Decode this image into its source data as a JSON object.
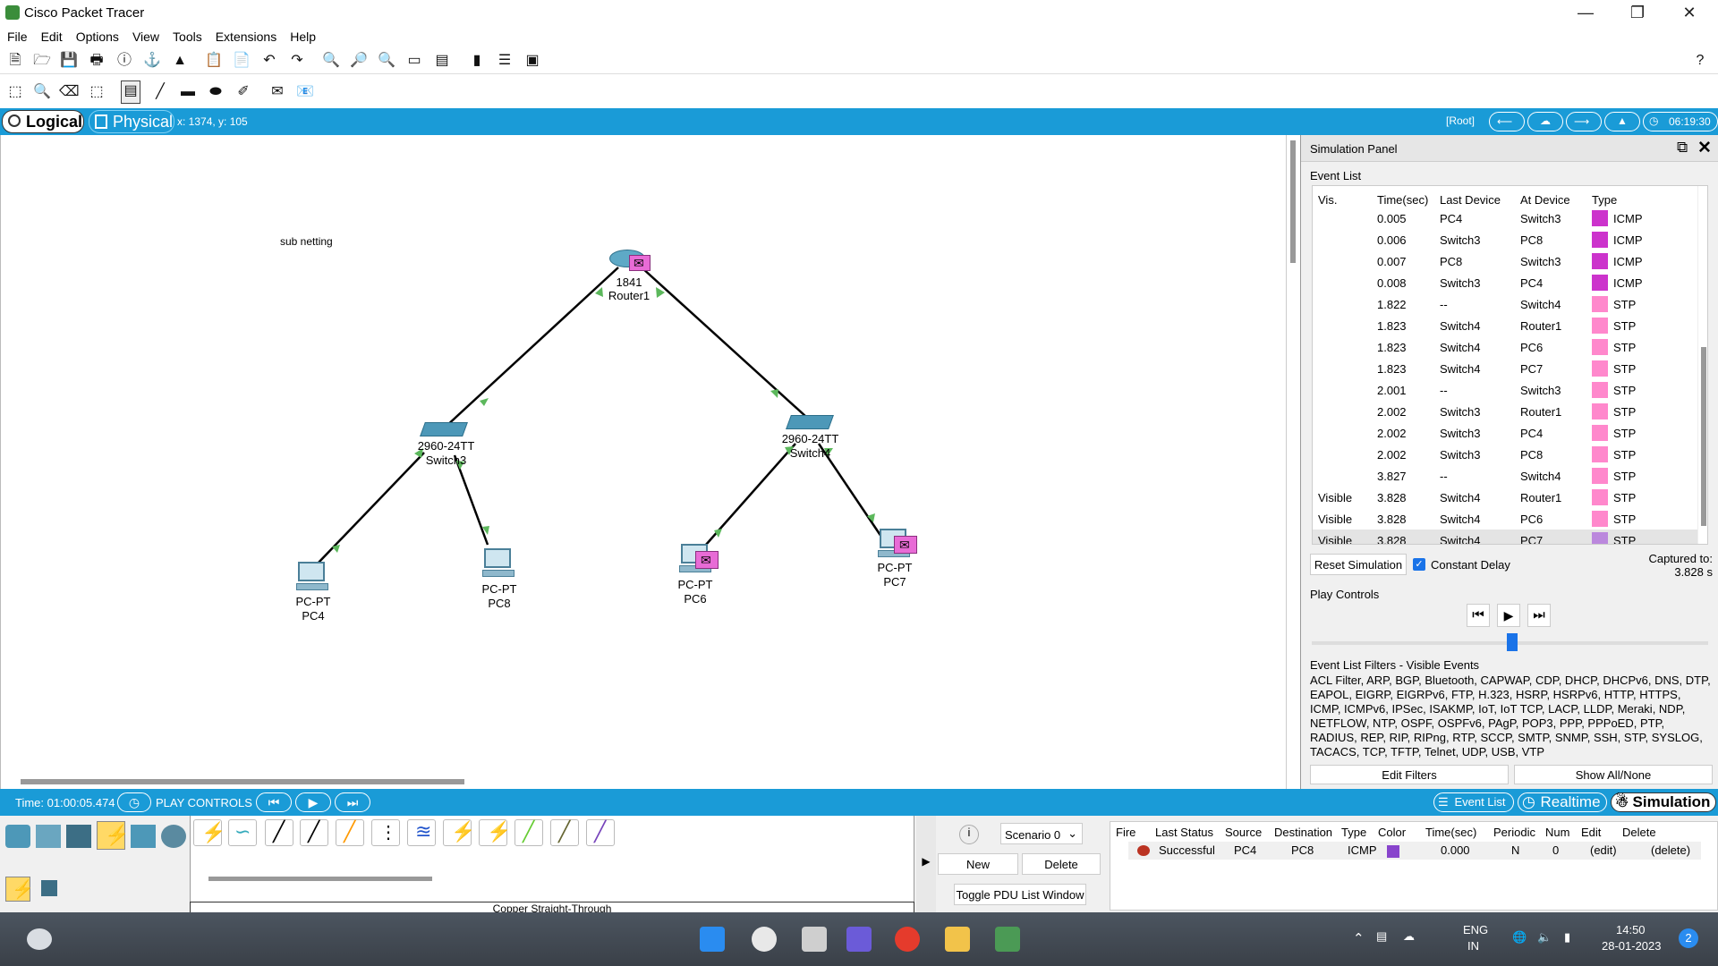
{
  "window": {
    "title": "Cisco Packet Tracer",
    "minimize": "—",
    "maximize": "❐",
    "close": "✕"
  },
  "menu": [
    "File",
    "Edit",
    "Options",
    "View",
    "Tools",
    "Extensions",
    "Help"
  ],
  "help_icon": "?",
  "modebar": {
    "logical": "Logical",
    "physical": "Physical",
    "coords": "x: 1374, y: 105",
    "root": "[Root]",
    "clock": "06:19:30"
  },
  "canvas": {
    "note": "sub netting",
    "devices": [
      {
        "model": "1841",
        "name": "Router1",
        "kind": "router"
      },
      {
        "model": "2960-24TT",
        "name": "Switch3",
        "kind": "switch"
      },
      {
        "model": "2960-24TT",
        "name": "Switch4",
        "kind": "switch"
      },
      {
        "model": "PC-PT",
        "name": "PC4",
        "kind": "pc"
      },
      {
        "model": "PC-PT",
        "name": "PC8",
        "kind": "pc"
      },
      {
        "model": "PC-PT",
        "name": "PC6",
        "kind": "pc"
      },
      {
        "model": "PC-PT",
        "name": "PC7",
        "kind": "pc"
      }
    ]
  },
  "sim": {
    "title": "Simulation Panel",
    "event_list_label": "Event List",
    "columns": [
      "Vis.",
      "Time(sec)",
      "Last Device",
      "At Device",
      "Type"
    ],
    "events": [
      {
        "vis": "",
        "time": "0.005",
        "last": "PC4",
        "at": "Switch3",
        "type": "ICMP",
        "color": "#cc33cc"
      },
      {
        "vis": "",
        "time": "0.006",
        "last": "Switch3",
        "at": "PC8",
        "type": "ICMP",
        "color": "#cc33cc"
      },
      {
        "vis": "",
        "time": "0.007",
        "last": "PC8",
        "at": "Switch3",
        "type": "ICMP",
        "color": "#cc33cc"
      },
      {
        "vis": "",
        "time": "0.008",
        "last": "Switch3",
        "at": "PC4",
        "type": "ICMP",
        "color": "#cc33cc"
      },
      {
        "vis": "",
        "time": "1.822",
        "last": "--",
        "at": "Switch4",
        "type": "STP",
        "color": "#ff88cc"
      },
      {
        "vis": "",
        "time": "1.823",
        "last": "Switch4",
        "at": "Router1",
        "type": "STP",
        "color": "#ff88cc"
      },
      {
        "vis": "",
        "time": "1.823",
        "last": "Switch4",
        "at": "PC6",
        "type": "STP",
        "color": "#ff88cc"
      },
      {
        "vis": "",
        "time": "1.823",
        "last": "Switch4",
        "at": "PC7",
        "type": "STP",
        "color": "#ff88cc"
      },
      {
        "vis": "",
        "time": "2.001",
        "last": "--",
        "at": "Switch3",
        "type": "STP",
        "color": "#ff88cc"
      },
      {
        "vis": "",
        "time": "2.002",
        "last": "Switch3",
        "at": "Router1",
        "type": "STP",
        "color": "#ff88cc"
      },
      {
        "vis": "",
        "time": "2.002",
        "last": "Switch3",
        "at": "PC4",
        "type": "STP",
        "color": "#ff88cc"
      },
      {
        "vis": "",
        "time": "2.002",
        "last": "Switch3",
        "at": "PC8",
        "type": "STP",
        "color": "#ff88cc"
      },
      {
        "vis": "",
        "time": "3.827",
        "last": "--",
        "at": "Switch4",
        "type": "STP",
        "color": "#ff88cc"
      },
      {
        "vis": "Visible",
        "time": "3.828",
        "last": "Switch4",
        "at": "Router1",
        "type": "STP",
        "color": "#ff88cc"
      },
      {
        "vis": "Visible",
        "time": "3.828",
        "last": "Switch4",
        "at": "PC6",
        "type": "STP",
        "color": "#ff88cc"
      },
      {
        "vis": "Visible",
        "time": "3.828",
        "last": "Switch4",
        "at": "PC7",
        "type": "STP",
        "color": "#bb88dd"
      }
    ],
    "reset": "Reset Simulation",
    "constant_delay": "Constant Delay",
    "captured_label": "Captured to:",
    "captured_value": "3.828 s",
    "play_controls": "Play Controls",
    "filters_title": "Event List Filters - Visible Events",
    "filters_text": "ACL Filter, ARP, BGP, Bluetooth, CAPWAP, CDP, DHCP, DHCPv6, DNS, DTP, EAPOL, EIGRP, EIGRPv6, FTP, H.323, HSRP, HSRPv6, HTTP, HTTPS, ICMP, ICMPv6, IPSec, ISAKMP, IoT, IoT TCP, LACP, LLDP, Meraki, NDP, NETFLOW, NTP, OSPF, OSPFv6, PAgP, POP3, PPP, PPPoED, PTP, RADIUS, REP, RIP, RIPng, RTP, SCCP, SMTP, SNMP, SSH, STP, SYSLOG, TACACS, TCP, TFTP, Telnet, UDP, USB, VTP",
    "edit_filters": "Edit Filters",
    "show_all": "Show All/None"
  },
  "bottombar": {
    "time": "Time: 01:00:05.474",
    "play_controls": "PLAY CONTROLS",
    "event_list": "Event List",
    "realtime": "Realtime",
    "simulation": "Simulation"
  },
  "devices_panel": {
    "cable_name": "Copper Straight-Through"
  },
  "scenario": {
    "selected": "Scenario 0",
    "new": "New",
    "delete": "Delete",
    "toggle": "Toggle PDU List Window"
  },
  "pdu": {
    "columns": [
      "Fire",
      "Last Status",
      "Source",
      "Destination",
      "Type",
      "Color",
      "Time(sec)",
      "Periodic",
      "Num",
      "Edit",
      "Delete"
    ],
    "row": {
      "status": "Successful",
      "source": "PC4",
      "destination": "PC8",
      "type": "ICMP",
      "color": "#8844cc",
      "time": "0.000",
      "periodic": "N",
      "num": "0",
      "edit": "(edit)",
      "delete": "(delete)"
    }
  },
  "taskbar": {
    "lang1": "ENG",
    "lang2": "IN",
    "time": "14:50",
    "date": "28-01-2023",
    "notif": "2"
  }
}
